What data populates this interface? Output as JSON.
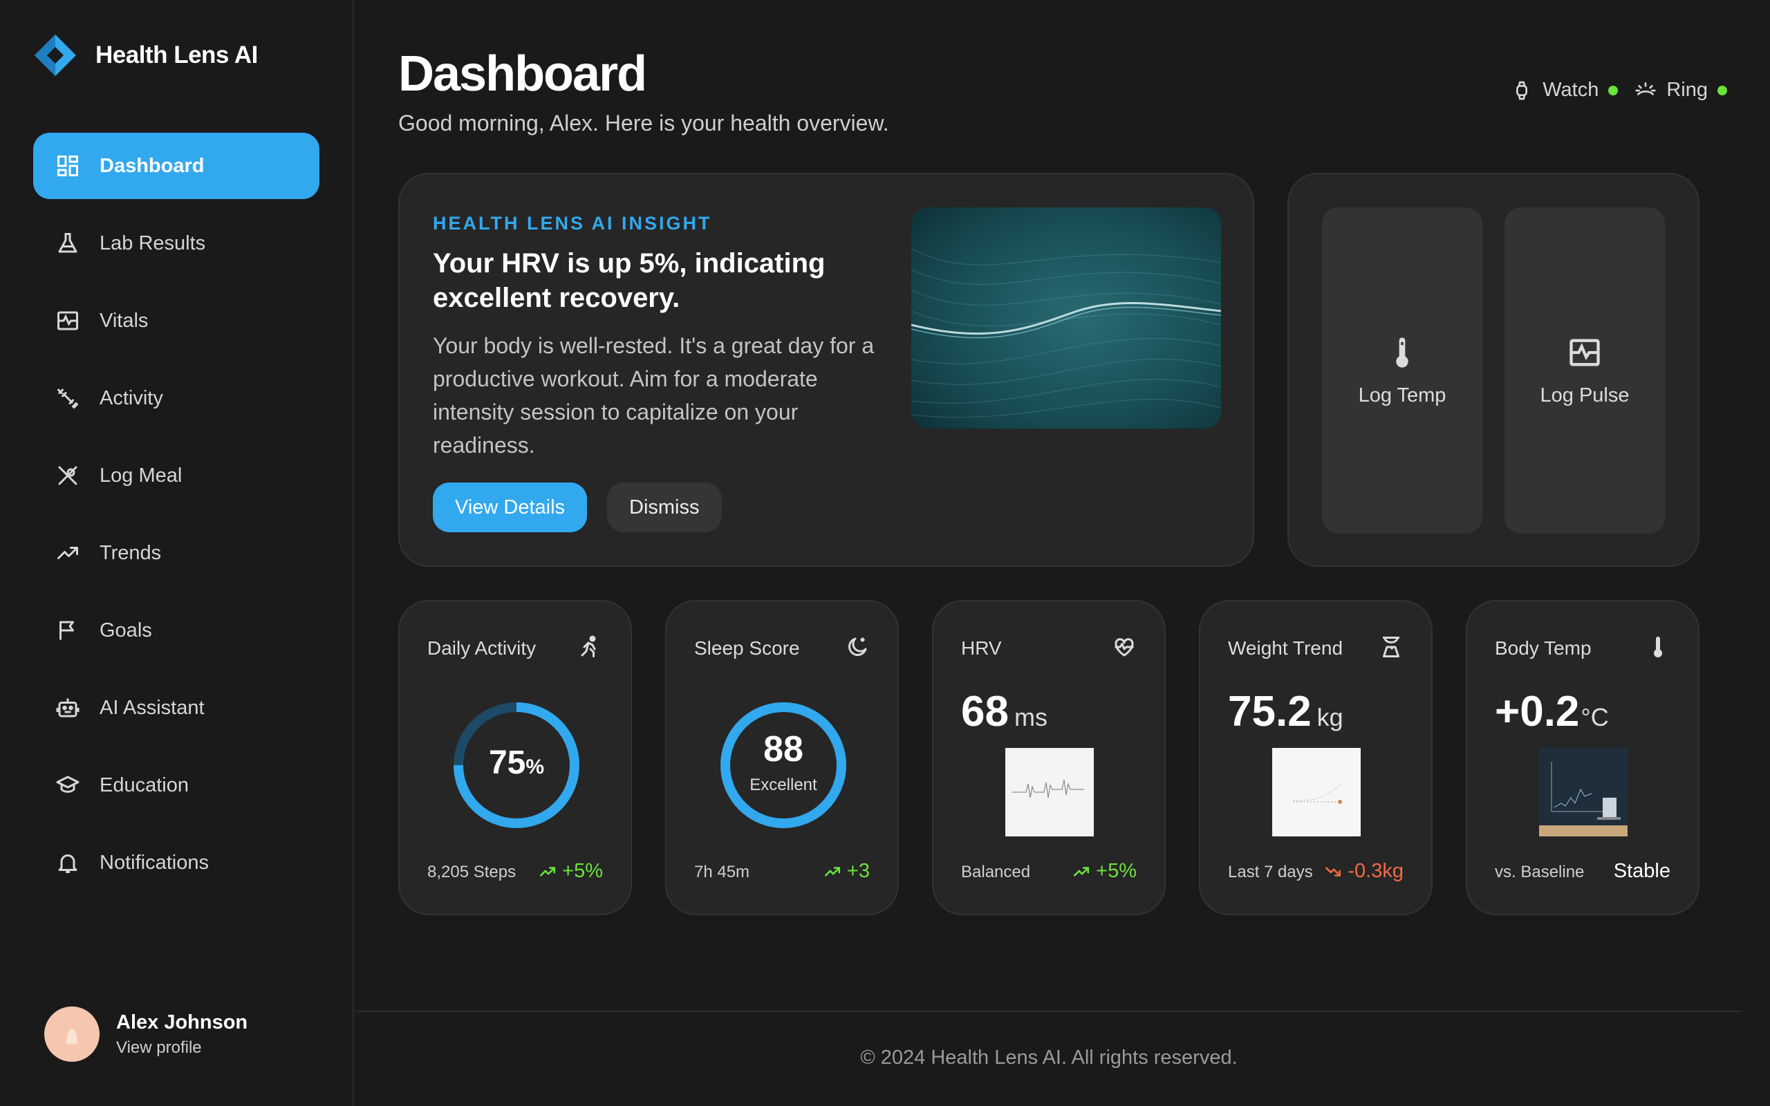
{
  "brand": {
    "name": "Health Lens AI",
    "logo_icon": "diamond-logo-icon",
    "accent": "#32a8ee"
  },
  "sidebar": {
    "items": [
      {
        "label": "Dashboard",
        "icon": "dashboard-icon",
        "active": true
      },
      {
        "label": "Lab Results",
        "icon": "flask-icon"
      },
      {
        "label": "Vitals",
        "icon": "vitals-monitor-icon"
      },
      {
        "label": "Activity",
        "icon": "dumbbell-icon"
      },
      {
        "label": "Log Meal",
        "icon": "utensils-icon"
      },
      {
        "label": "Trends",
        "icon": "trending-up-icon"
      },
      {
        "label": "Goals",
        "icon": "flag-icon"
      },
      {
        "label": "AI Assistant",
        "icon": "robot-icon"
      },
      {
        "label": "Education",
        "icon": "graduation-cap-icon"
      },
      {
        "label": "Notifications",
        "icon": "bell-icon"
      }
    ],
    "profile": {
      "name": "Alex Johnson",
      "link": "View profile"
    }
  },
  "header": {
    "title": "Dashboard",
    "subtitle": "Good morning, Alex. Here is your health overview.",
    "devices": [
      {
        "label": "Watch",
        "icon": "watch-icon",
        "status_color": "#6be33a"
      },
      {
        "label": "Ring",
        "icon": "ring-sensor-icon",
        "status_color": "#6be33a"
      }
    ]
  },
  "insight": {
    "kicker": "HEALTH LENS AI INSIGHT",
    "headline": "Your HRV is up 5%, indicating excellent recovery.",
    "body": "Your body is well-rested. It's a great day for a productive workout. Aim for a moderate intensity session to capitalize on your readiness.",
    "primary_button": "View Details",
    "secondary_button": "Dismiss"
  },
  "quick_log": [
    {
      "label": "Log Temp",
      "icon": "thermometer-icon"
    },
    {
      "label": "Log Pulse",
      "icon": "pulse-monitor-icon"
    }
  ],
  "metrics": {
    "activity": {
      "title": "Daily Activity",
      "icon": "running-icon",
      "value": "75",
      "unit": "%",
      "progress": 0.75,
      "footer": "8,205 Steps",
      "trend": "+5%",
      "trend_dir": "up"
    },
    "sleep": {
      "title": "Sleep Score",
      "icon": "moon-star-icon",
      "value": "88",
      "caption": "Excellent",
      "progress": 1.0,
      "footer": "7h 45m",
      "trend": "+3",
      "trend_dir": "up"
    },
    "hrv": {
      "title": "HRV",
      "icon": "heart-pulse-icon",
      "value": "68",
      "unit": "ms",
      "footer": "Balanced",
      "trend": "+5%",
      "trend_dir": "up"
    },
    "weight": {
      "title": "Weight Trend",
      "icon": "scale-icon",
      "value": "75.2",
      "unit": "kg",
      "footer": "Last 7 days",
      "trend": "-0.3kg",
      "trend_dir": "down"
    },
    "temp": {
      "title": "Body Temp",
      "icon": "thermometer-icon",
      "value": "+0.2",
      "unit": "°C",
      "footer": "vs. Baseline",
      "status": "Stable"
    }
  },
  "colors": {
    "trend_up": "#6be33a",
    "trend_down": "#f36a44",
    "ring": "#32a8ee"
  },
  "footer": {
    "text": "© 2024 Health Lens AI. All rights reserved."
  }
}
